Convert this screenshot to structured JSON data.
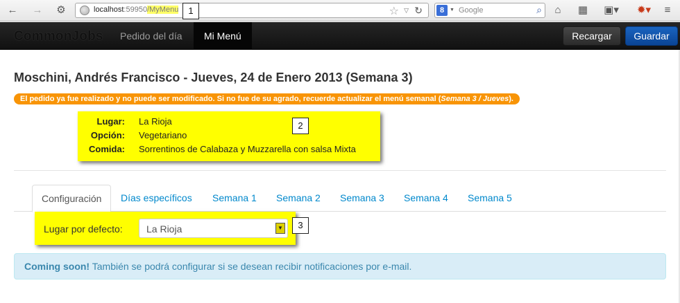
{
  "browser": {
    "url_host": "localhost",
    "url_port": ":59950",
    "url_path": "/MyMenu",
    "search_placeholder": "Google",
    "search_engine_letter": "8"
  },
  "navbar": {
    "brand": "CommonJobs",
    "links": [
      {
        "label": "Pedido del día",
        "active": false
      },
      {
        "label": "Mi Menú",
        "active": true
      }
    ],
    "reload_label": "Recargar",
    "save_label": "Guardar"
  },
  "page": {
    "title": "Moschini, Andrés Francisco - Jueves, 24 de Enero 2013 (Semana 3)",
    "warning_prefix": "El pedido ya fue realizado y no puede ser modificado. Si no fue de su agrado, recuerde actualizar el menú semanal (",
    "warning_emphasis": "Semana 3 / Jueves",
    "warning_suffix": ")."
  },
  "order": {
    "rows": [
      {
        "key": "Lugar:",
        "value": "La Rioja"
      },
      {
        "key": "Opción:",
        "value": "Vegetariano"
      },
      {
        "key": "Comida:",
        "value": "Sorrentinos de Calabaza y Muzzarella con salsa Mixta"
      }
    ]
  },
  "tabs": [
    {
      "label": "Configuración",
      "active": true
    },
    {
      "label": "Días específicos",
      "active": false
    },
    {
      "label": "Semana 1",
      "active": false
    },
    {
      "label": "Semana 2",
      "active": false
    },
    {
      "label": "Semana 3",
      "active": false
    },
    {
      "label": "Semana 4",
      "active": false
    },
    {
      "label": "Semana 5",
      "active": false
    }
  ],
  "config": {
    "default_place_label": "Lugar por defecto:",
    "default_place_value": "La Rioja"
  },
  "alert": {
    "strong": "Coming soon!",
    "text": " También se podrá configurar si se desean recibir notificaciones por e-mail."
  },
  "callouts": [
    "1",
    "2",
    "3"
  ],
  "colors": {
    "highlight": "#ffff00",
    "warning": "#f89406",
    "primary": "#0a4495",
    "link": "#0088cc",
    "alert_bg": "#d9edf7"
  }
}
